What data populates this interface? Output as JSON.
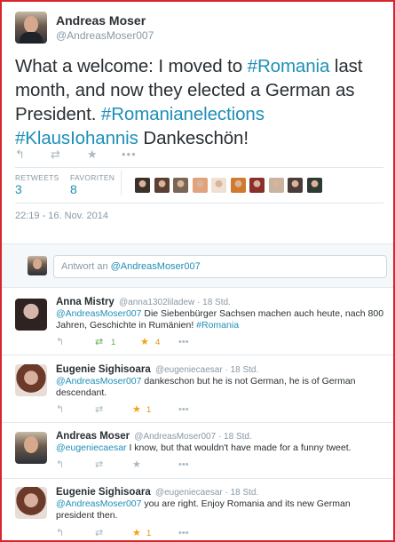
{
  "tweet": {
    "name": "Andreas Moser",
    "handle": "@AndreasMoser007",
    "text_parts": {
      "p1": "What a welcome: I moved to ",
      "h1": "#Romania",
      "p2": " last month, and now they elected a German as President. ",
      "h2": "#Romanianelections",
      "h3": "#KlausIohannis",
      "p3": " Dankeschön!"
    },
    "actions": {
      "reply_icon": "reply-icon",
      "retweet_icon": "retweet-icon",
      "favorite_icon": "star-icon",
      "more_icon": "more-icon"
    },
    "stats": {
      "retweets_label": "RETWEETS",
      "retweets_value": "3",
      "favorites_label": "FAVORITEN",
      "favorites_value": "8"
    },
    "favoriters": [
      {
        "color": "#3b3128"
      },
      {
        "color": "#5b3f33"
      },
      {
        "color": "#7a6656"
      },
      {
        "color": "#e2a27b"
      },
      {
        "color": "#f0e0d4"
      },
      {
        "color": "#d27a2c"
      },
      {
        "color": "#8a2f2a"
      },
      {
        "color": "#c9b3a1"
      },
      {
        "color": "#4a3c38"
      },
      {
        "color": "#2f3a30"
      }
    ],
    "timestamp": "22:19 - 16. Nov. 2014"
  },
  "reply_box": {
    "prefix": "Antwort an ",
    "mention": "@AndreasMoser007"
  },
  "replies": [
    {
      "name": "Anna Mistry",
      "handle": "@anna1302liladew · 18 Std.",
      "mention": "@AndreasMoser007",
      "text": " Die Siebenbürger Sachsen machen auch heute, nach 800 Jahren, Geschichte in Rumänien! ",
      "hashtag": "#Romania",
      "retweets": "1",
      "favorites": "4"
    },
    {
      "name": "Eugenie Sighisoara",
      "handle": "@eugeniecaesar · 18 Std.",
      "mention": "@AndreasMoser007",
      "text": " dankeschon but he is not German, he is of German descendant.",
      "favorites": "1"
    },
    {
      "name": "Andreas Moser",
      "handle": "@AndreasMoser007 · 18 Std.",
      "mention": "@eugeniecaesar",
      "text": " I know, but that wouldn't have made for a funny tweet."
    },
    {
      "name": "Eugenie Sighisoara",
      "handle": "@eugeniecaesar · 18 Std.",
      "mention": "@AndreasMoser007",
      "text": " you are right. Enjoy Romania and its new German president then.",
      "favorites": "1"
    }
  ],
  "colors": {
    "link": "#1e8fb8",
    "retweet_active": "#5fb04c",
    "favorite_active": "#f2a30f",
    "border": "#d8262b"
  }
}
